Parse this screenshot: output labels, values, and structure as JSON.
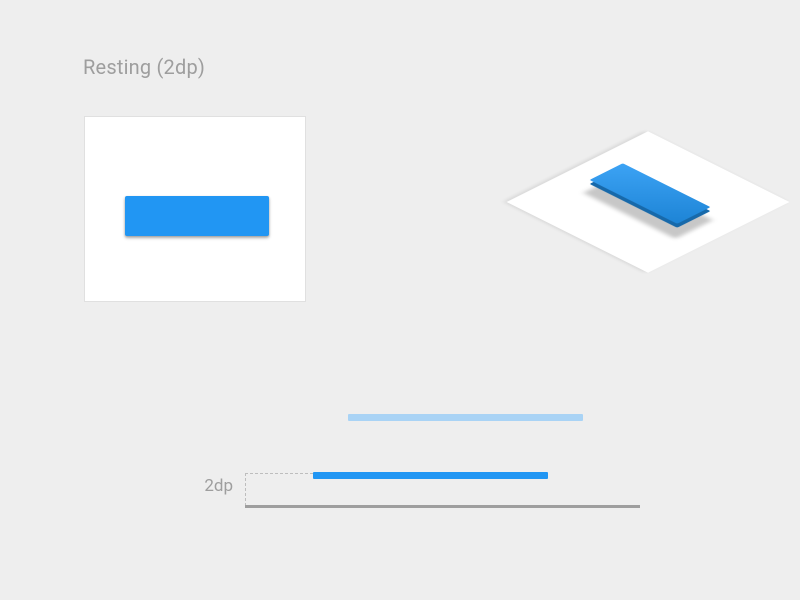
{
  "title": "Resting (2dp)",
  "side_label": "2dp",
  "colors": {
    "accent": "#2196f3",
    "accent_light": "#a9d3f5",
    "surface": "#ffffff",
    "background": "#eeeeee",
    "line": "#9e9e9e"
  },
  "elevation_dp": 2
}
